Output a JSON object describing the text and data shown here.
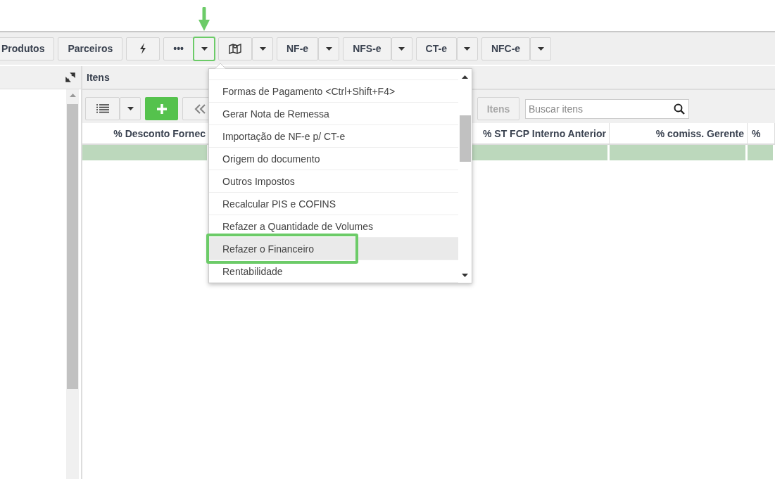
{
  "toolbar": {
    "groups": [
      {
        "buttons": [
          {
            "kind": "text",
            "label": "Produtos",
            "annotated": false
          }
        ]
      },
      {
        "buttons": [
          {
            "kind": "text",
            "label": "Parceiros",
            "annotated": false
          }
        ]
      },
      {
        "buttons": [
          {
            "kind": "bolt",
            "annotated": false
          }
        ]
      },
      {
        "buttons": [
          {
            "kind": "text",
            "label": "•••",
            "annotated": false
          },
          {
            "kind": "caret",
            "annotated": true
          }
        ]
      },
      {
        "buttons": [
          {
            "kind": "map",
            "annotated": false
          },
          {
            "kind": "caret",
            "annotated": false
          }
        ]
      },
      {
        "buttons": [
          {
            "kind": "text",
            "label": "NF-e",
            "annotated": false
          },
          {
            "kind": "caret",
            "annotated": false
          }
        ]
      },
      {
        "buttons": [
          {
            "kind": "text",
            "label": "NFS-e",
            "annotated": false
          },
          {
            "kind": "caret",
            "annotated": false
          }
        ]
      },
      {
        "buttons": [
          {
            "kind": "text",
            "label": "CT-e",
            "annotated": false
          },
          {
            "kind": "caret",
            "annotated": false
          }
        ]
      },
      {
        "buttons": [
          {
            "kind": "text",
            "label": "NFC-e",
            "annotated": false
          },
          {
            "kind": "caret",
            "annotated": false
          }
        ]
      }
    ]
  },
  "items_panel": {
    "title": "Itens",
    "disabled_button": "Itens",
    "search": {
      "placeholder": "Buscar itens"
    },
    "columns": [
      "% Desconto Fornec",
      "% ST FCP Interno Anterior",
      "% comiss. Gerente",
      "%"
    ]
  },
  "menu": {
    "items": [
      {
        "label": "Formas de Pagamento <Ctrl+Shift+F4>",
        "selected": false,
        "annotated": false
      },
      {
        "label": "Gerar Nota de Remessa",
        "selected": false,
        "annotated": false
      },
      {
        "label": "Importação de NF-e p/ CT-e",
        "selected": false,
        "annotated": false
      },
      {
        "label": "Origem do documento",
        "selected": false,
        "annotated": false
      },
      {
        "label": "Outros Impostos",
        "selected": false,
        "annotated": false
      },
      {
        "label": "Recalcular PIS e COFINS",
        "selected": false,
        "annotated": false
      },
      {
        "label": "Refazer a Quantidade de Volumes",
        "selected": false,
        "annotated": false
      },
      {
        "label": "Refazer o Financeiro",
        "selected": true,
        "annotated": true
      },
      {
        "label": "Rentabilidade",
        "selected": false,
        "annotated": false
      }
    ]
  }
}
